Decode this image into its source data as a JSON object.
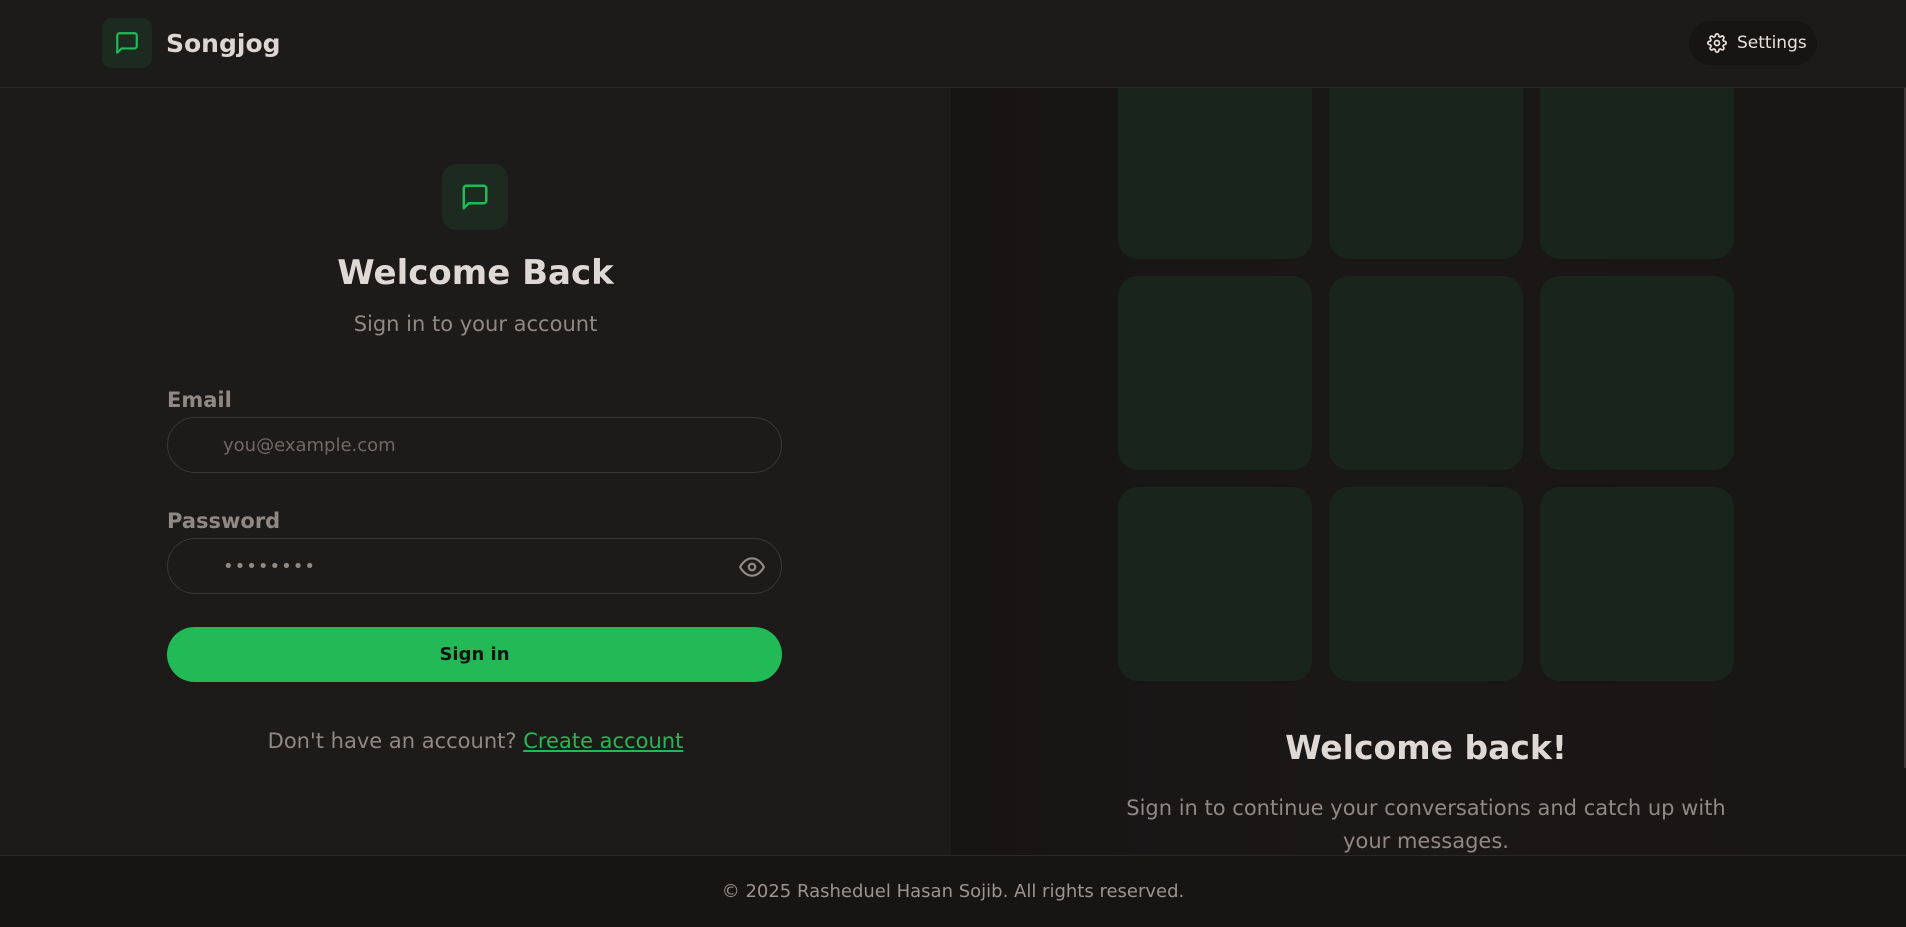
{
  "header": {
    "brand_name": "Songjog",
    "brand_icon": "message-square-icon",
    "settings_label": "Settings",
    "settings_icon": "gear-icon"
  },
  "login_form": {
    "logo_icon": "message-square-icon",
    "title": "Welcome Back",
    "subtitle": "Sign in to your account",
    "email_label": "Email",
    "email_placeholder": "you@example.com",
    "email_value": "",
    "password_label": "Password",
    "password_value": "••••••••",
    "password_toggle_icon": "eye-icon",
    "submit_label": "Sign in",
    "signup_prompt": "Don't have an account?",
    "signup_link": "Create account"
  },
  "promo": {
    "tile_count": 9,
    "title": "Welcome back!",
    "text": "Sign in to continue your conversations and catch up with your messages."
  },
  "footer": {
    "copyright": "© 2025 Rasheduel Hasan Sojib. All rights reserved."
  },
  "colors": {
    "accent": "#22b957",
    "background": "#1d1a1a",
    "tile": "#19241c"
  }
}
